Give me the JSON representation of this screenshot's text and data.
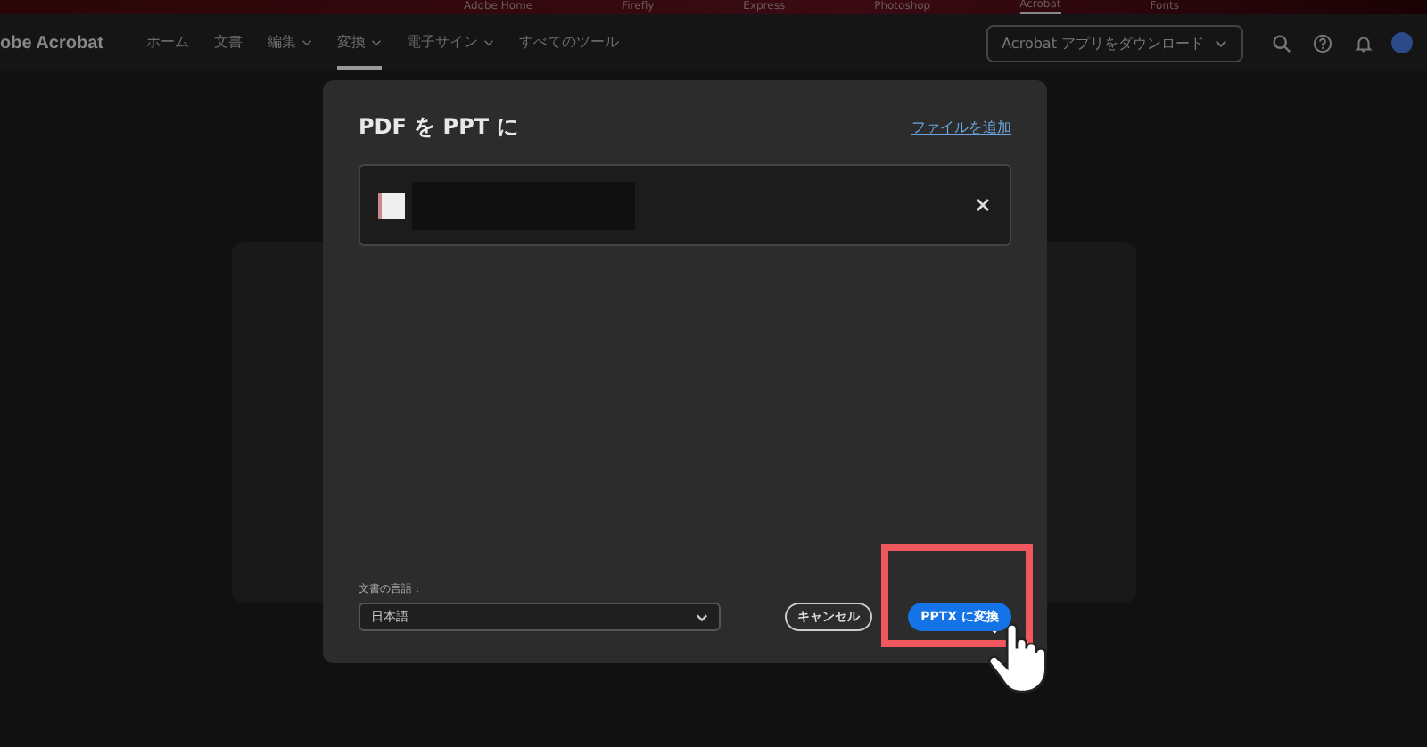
{
  "app_switcher": [
    {
      "label": "Adobe Home",
      "selected": false
    },
    {
      "label": "Firefly",
      "selected": false
    },
    {
      "label": "Express",
      "selected": false
    },
    {
      "label": "Photoshop",
      "selected": false
    },
    {
      "label": "Acrobat",
      "selected": true
    },
    {
      "label": "Fonts",
      "selected": false
    }
  ],
  "app_name": "obe Acrobat",
  "nav": [
    {
      "label": "ホーム",
      "dropdown": false,
      "selected": false
    },
    {
      "label": "文書",
      "dropdown": false,
      "selected": false
    },
    {
      "label": "編集",
      "dropdown": true,
      "selected": false
    },
    {
      "label": "変換",
      "dropdown": true,
      "selected": true
    },
    {
      "label": "電子サイン",
      "dropdown": true,
      "selected": false
    },
    {
      "label": "すべてのツール",
      "dropdown": false,
      "selected": false
    }
  ],
  "download_button": "Acrobat アプリをダウンロード",
  "dialog": {
    "title": "PDF を PPT に",
    "add_files_link": "ファイルを追加",
    "language_label": "文書の言語：",
    "language_value": "日本語",
    "cancel_button": "キャンセル",
    "convert_button": "PPTX に変換"
  }
}
